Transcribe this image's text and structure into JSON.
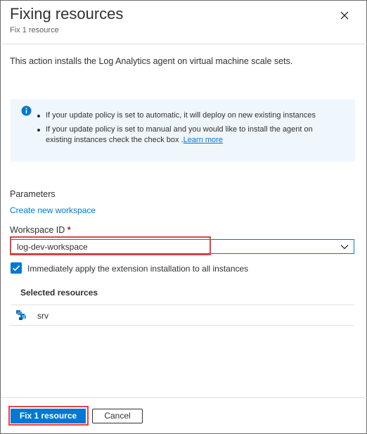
{
  "panel": {
    "title": "Fixing resources",
    "subtitle": "Fix 1 resource"
  },
  "description": "This action installs the Log Analytics agent on virtual machine scale sets.",
  "info": {
    "bullets": [
      "If your update policy is set to automatic, it will deploy on new existing instances",
      "If your update policy is set to manual and you would like to install the agent on existing instances check the check box ."
    ],
    "learn_more": "Learn more"
  },
  "parameters": {
    "label": "Parameters",
    "create_link": "Create new workspace",
    "workspace_label": "Workspace ID",
    "required_marker": "*",
    "workspace_value": "log-dev-workspace"
  },
  "checkbox": {
    "checked": true,
    "label": "Immediately apply the extension installation to all instances"
  },
  "selected": {
    "header": "Selected resources",
    "resources": [
      {
        "name": "srv",
        "icon": "vmss-icon"
      }
    ]
  },
  "footer": {
    "fix_label": "Fix 1 resource",
    "cancel_label": "Cancel"
  },
  "colors": {
    "accent": "#0078d4",
    "info_bg": "#eff6fc",
    "highlight": "#e04343",
    "required": "#a4262c"
  }
}
